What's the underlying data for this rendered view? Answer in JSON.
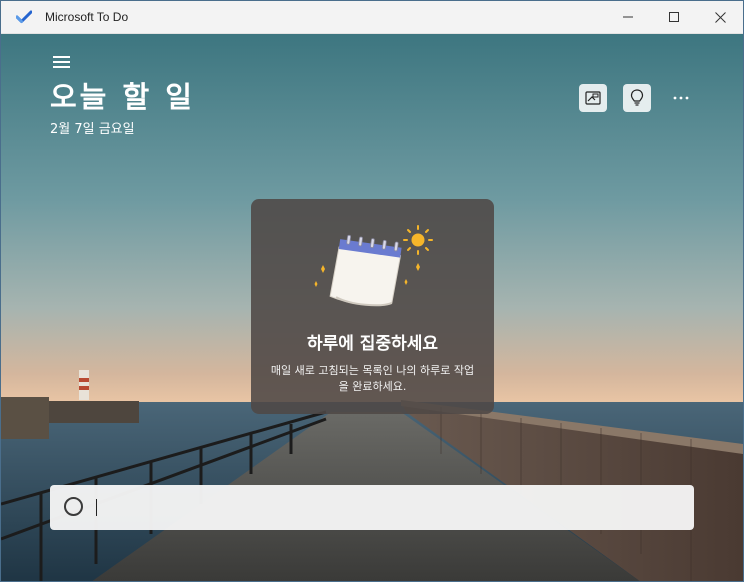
{
  "window": {
    "title": "Microsoft To Do",
    "controls": [
      "minimize",
      "maximize",
      "close"
    ]
  },
  "header": {
    "title": "오늘 할 일",
    "date": "2월 7일 금요일",
    "icons": [
      "hamburger-menu-icon",
      "background-picture-icon",
      "lightbulb-icon",
      "more-icon"
    ]
  },
  "focus_card": {
    "heading": "하루에 집중하세요",
    "description": "매일 새로 고침되는 목록인 나의 하루로 작업을 완료하세요.",
    "illustration": "calendar-sun-icon"
  },
  "add_task": {
    "value": "",
    "placeholder": ""
  },
  "colors": {
    "accent": "#2564cf",
    "titlebar": "#f3f3f3",
    "card": "#4e4846",
    "sun": "#f5b52a"
  }
}
